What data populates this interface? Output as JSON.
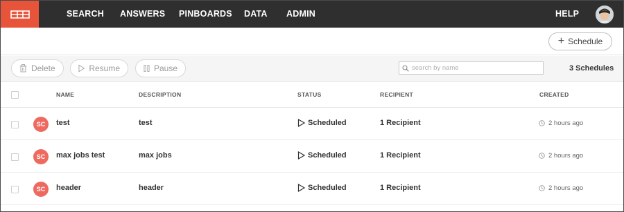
{
  "nav": {
    "items": [
      "SEARCH",
      "ANSWERS",
      "PINBOARDS",
      "DATA",
      "ADMIN"
    ],
    "help": "HELP"
  },
  "colors": {
    "brand": "#e8543a",
    "nav_bg": "#2f2f2f",
    "badge": "#ee6a60"
  },
  "actions": {
    "schedule_label": "Schedule"
  },
  "toolbar": {
    "delete_label": "Delete",
    "resume_label": "Resume",
    "pause_label": "Pause",
    "search_placeholder": "search by name",
    "count": "3 Schedules"
  },
  "table": {
    "headers": [
      "NAME",
      "DESCRIPTION",
      "STATUS",
      "RECIPIENT",
      "CREATED"
    ],
    "rows": [
      {
        "initials": "SC",
        "name": "test",
        "description": "test",
        "status": "Scheduled",
        "recipient": "1 Recipient",
        "created": "2 hours ago"
      },
      {
        "initials": "SC",
        "name": "max jobs test",
        "description": "max jobs",
        "status": "Scheduled",
        "recipient": "1 Recipient",
        "created": "2 hours ago"
      },
      {
        "initials": "SC",
        "name": "header",
        "description": "header",
        "status": "Scheduled",
        "recipient": "1 Recipient",
        "created": "2 hours ago"
      }
    ]
  }
}
